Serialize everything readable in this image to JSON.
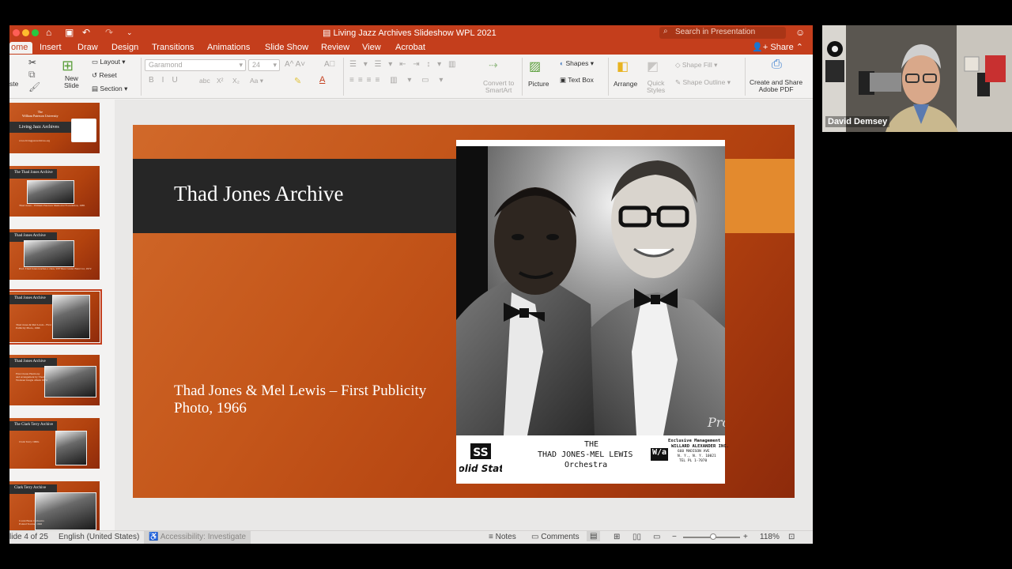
{
  "window": {
    "doc_title": "Living Jazz Archives Slideshow WPL 2021",
    "search_placeholder": "Search in Presentation",
    "share_label": "Share"
  },
  "tabs": [
    "ome",
    "Insert",
    "Draw",
    "Design",
    "Transitions",
    "Animations",
    "Slide Show",
    "Review",
    "View",
    "Acrobat"
  ],
  "ribbon": {
    "paste_label": "ste",
    "new_slide_label": "New\nSlide",
    "layout_label": "Layout",
    "reset_label": "Reset",
    "section_label": "Section",
    "font_name": "Garamond",
    "font_size": "24",
    "convert_label": "Convert to\nSmartArt",
    "picture_label": "Picture",
    "shapes_label": "Shapes",
    "text_box_label": "Text Box",
    "arrange_label": "Arrange",
    "quick_styles_label": "Quick\nStyles",
    "shape_fill_label": "Shape Fill",
    "shape_outline_label": "Shape Outline",
    "create_share_label": "Create and Share\nAdobe PDF"
  },
  "thumbnails": [
    {
      "title": "The\nWilliam Paterson University",
      "subtitle": "Living Jazz Archives",
      "caption": "www.livingjazzarchives.org"
    },
    {
      "title": "The Thad Jones Archive",
      "caption": "Thad Jones - William Paterson Memorial Foundation, 1985"
    },
    {
      "title": "Thad Jones Archive",
      "caption": "Prof. Thad Jones teaches a class, WP Shea Center Band 1st, 1972"
    },
    {
      "title": "Thad Jones Archive",
      "caption": "Thad Jones & Mel Lewis - First\nPublicity Photo, 1966"
    },
    {
      "title": "Thad Jones Archive",
      "caption": "First Ocean Harmony\nand arrangement by Thad\nWorkout Jungle album 1974"
    },
    {
      "title": "The Clark Terry Archive",
      "caption": "Clark Terry 1960s"
    },
    {
      "title": "Clark Terry Archive",
      "caption": "Count Basie Orchestra\nPoland Tourne, 1946"
    }
  ],
  "slide": {
    "title": "Thad Jones Archive",
    "caption": "Thad Jones & Mel Lewis – First Publicity Photo, 1966",
    "photo_band": {
      "label_logo": "SS",
      "label_logo_sub": "Solid State",
      "the": "THE",
      "orchestra_line": "THAD JONES-MEL LEWIS",
      "orchestra_word": "Orchestra",
      "mgmt_header": "Exclusive Management",
      "mgmt_name": "WILLARD ALEXANDER INC.",
      "mgmt_addr1": "660 MADISON AVE",
      "mgmt_addr2": "N. Y., N. Y. 10021",
      "mgmt_tel": "TEL PL 1-7070"
    }
  },
  "statusbar": {
    "slide_counter": "lide 4 of 25",
    "language": "English (United States)",
    "accessibility": "Accessibility: Investigate",
    "notes": "Notes",
    "comments": "Comments",
    "zoom": "118%"
  },
  "video": {
    "participant_name": "David Demsey"
  },
  "colors": {
    "ppt_accent": "#c43e1c",
    "slide_orange": "#c4561a",
    "slide_bar": "#262626",
    "slide_accent": "#e38a2e"
  }
}
